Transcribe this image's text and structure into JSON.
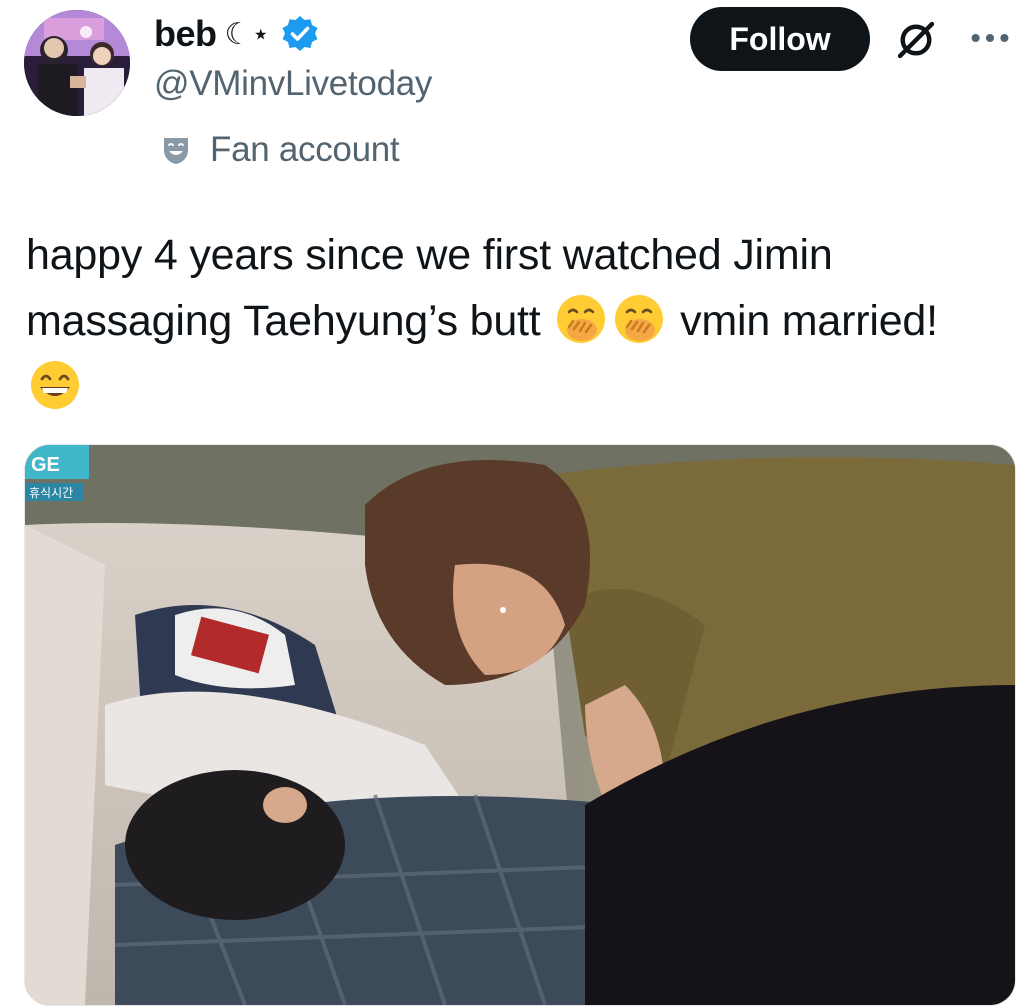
{
  "author": {
    "display_name": "beb",
    "name_glyph": "☾⋆",
    "handle": "@VMinvLivetoday",
    "verified": true,
    "label": "Fan account",
    "label_icon": "theater-masks-icon"
  },
  "actions": {
    "follow_label": "Follow",
    "grok_icon": "grok-icon",
    "more_icon": "more-icon"
  },
  "tweet": {
    "line1": "happy 4 years since we first watched Jimin",
    "line2_text": "massaging Taehyung’s butt",
    "line2_tail": "vmin married!",
    "emojis": [
      "face-with-hand-over-mouth",
      "face-with-hand-over-mouth",
      "beaming-face-with-smiling-eyes"
    ]
  },
  "media": {
    "type": "video-thumbnail",
    "overlay_text": "GE",
    "overlay_subtext": "휴식시간"
  },
  "colors": {
    "text_primary": "#0f1419",
    "text_secondary": "#536471",
    "verified_blue": "#1d9bf0",
    "button_bg": "#0f1419"
  }
}
